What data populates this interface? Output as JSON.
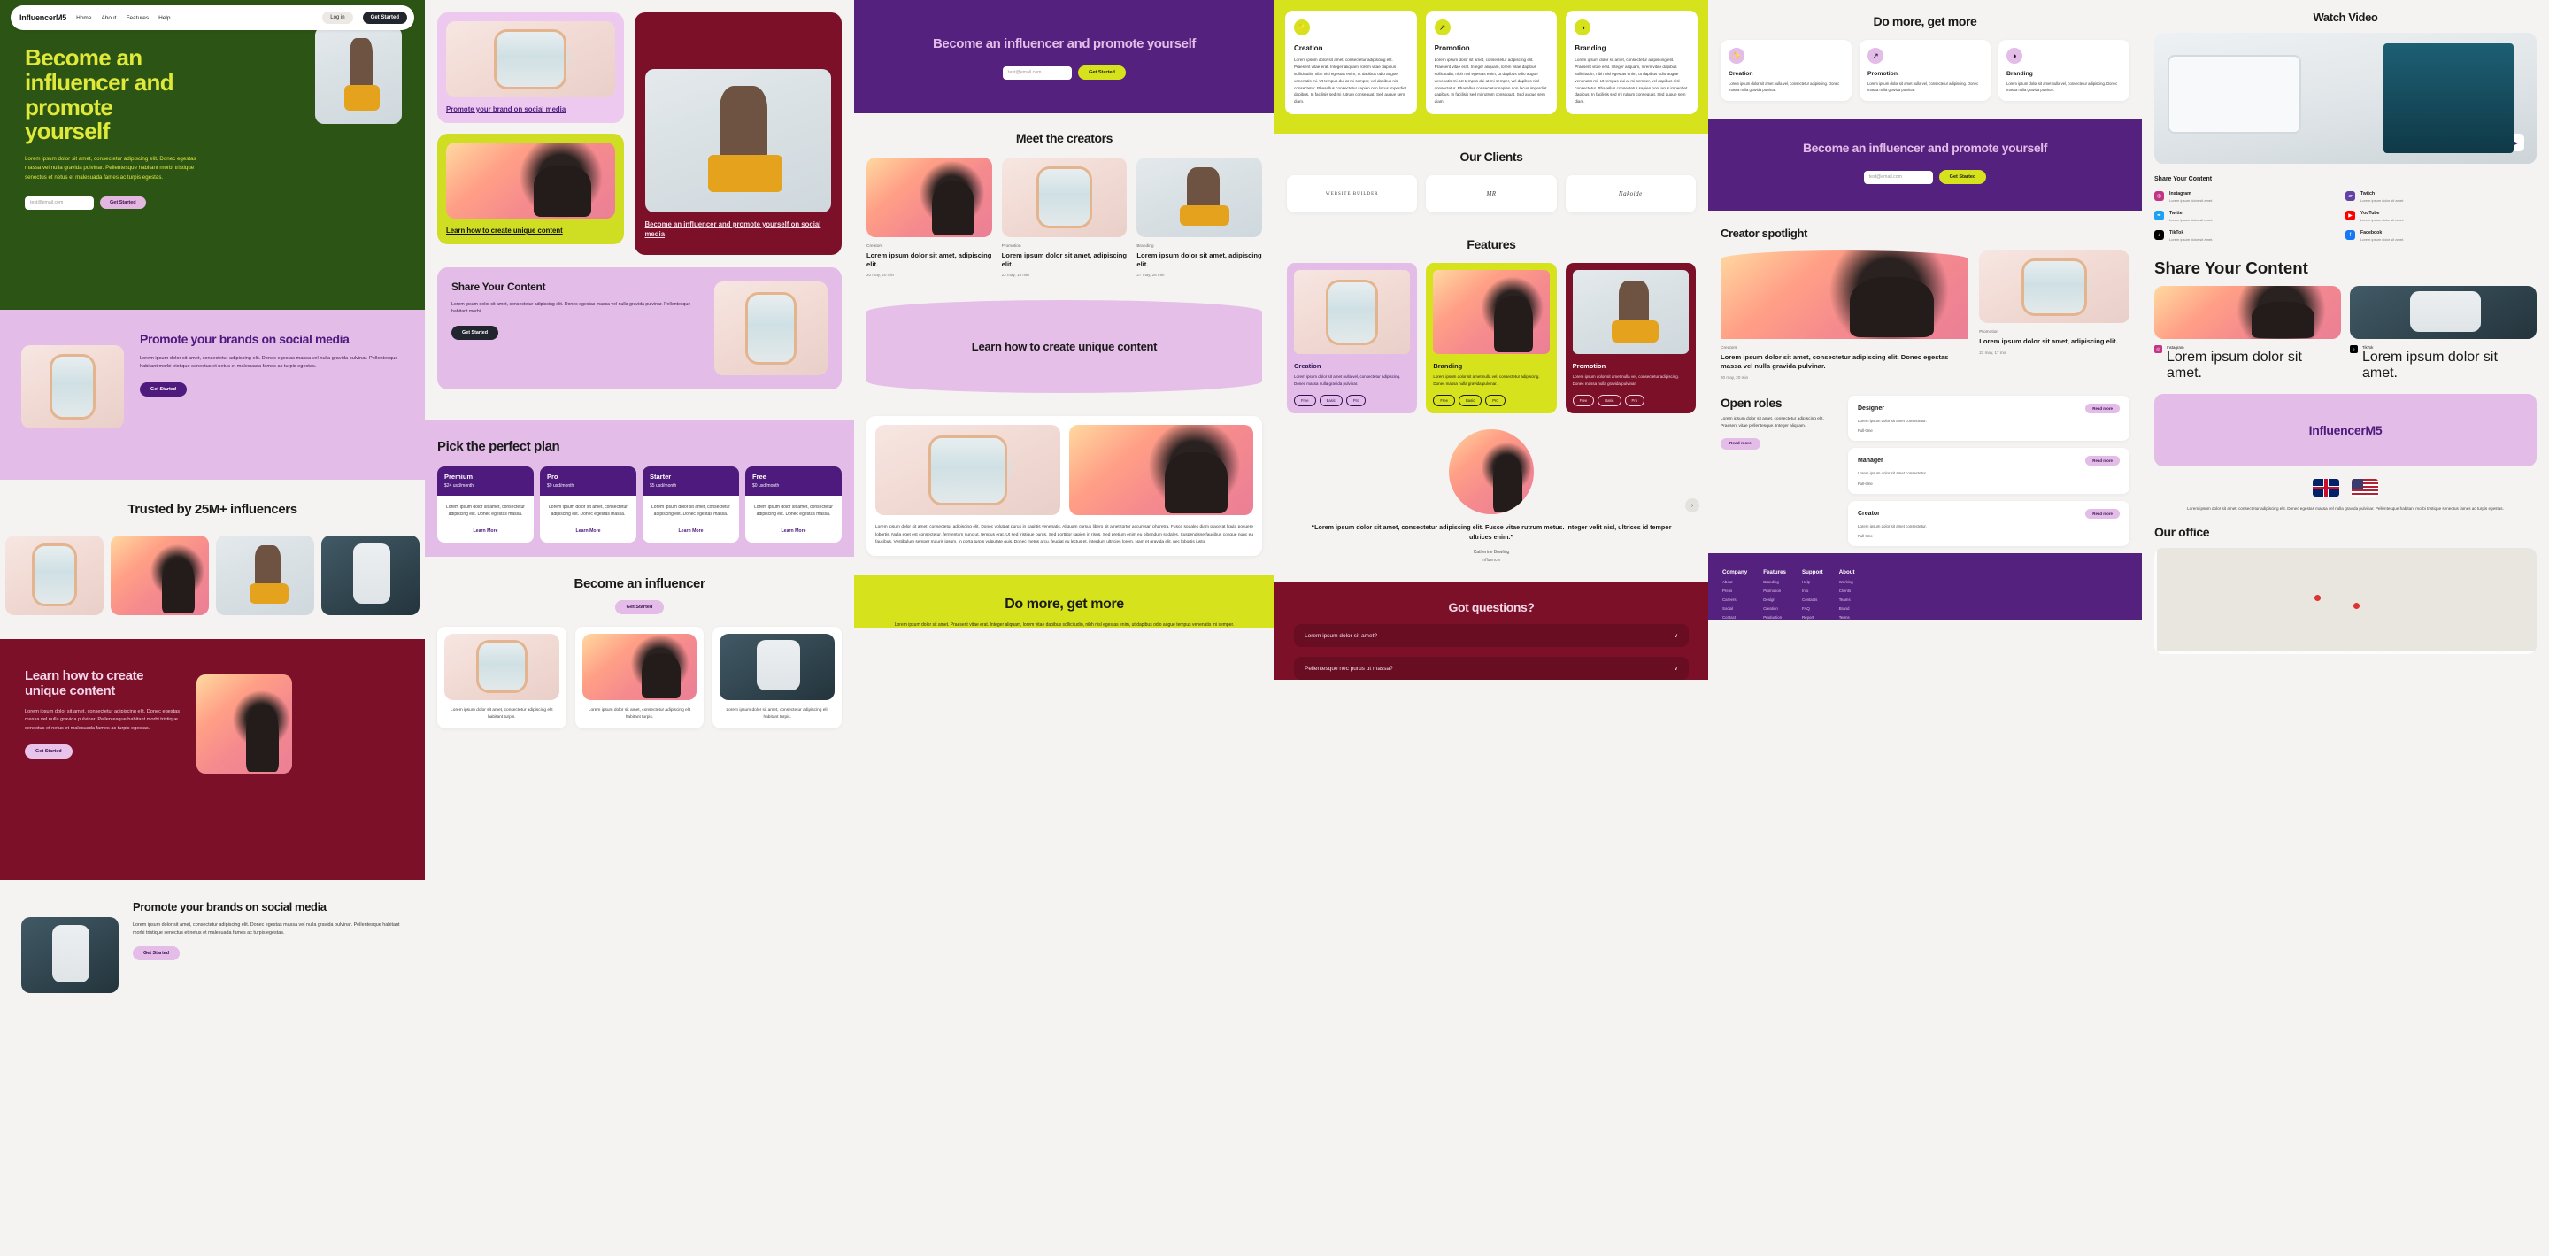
{
  "brand": "InfluencerM5",
  "nav": {
    "links": [
      "Home",
      "About",
      "Features",
      "Help"
    ],
    "login": "Log in",
    "get_started": "Get Started"
  },
  "common": {
    "get_started": "Get Started",
    "learn_more": "Learn More",
    "read_more": "Read more",
    "email_placeholder": "test@email.com",
    "lorem_long": "Lorem ipsum dolor sit amet, consectetur adipiscing elit. Donec egestas massa vel nulla gravida pulvinar. Pellentesque habitant morbi tristique senectus et netus et malesuada fames ac turpis egestas.",
    "lorem_mid": "Lorem ipsum dolor sit amet, consectetur adipiscing elit. Donec egestas massa vel nulla gravida pulvinar. Pellentesque habitant morbi.",
    "lorem_short": "Lorem ipsum dolor sit amet nulla vel, consectetur adipiscing. Donec massa nulla gravida pulvinar.",
    "lorem_card": "Lorem ipsum dolor sit amet, consectetur adipiscing elit. Donec egestas massa.",
    "lorem_tiny": "Lorem ipsum dolor sit amet, consectetur adipiscing elit habitant turpis."
  },
  "colors": {
    "green": "#2c5415",
    "lime": "#d6e31c",
    "lilac": "#e3bce8",
    "purple": "#55217e",
    "maroon": "#7c1028",
    "ink": "#22242e"
  },
  "hero_green": {
    "title": "Become an influencer and promote yourself",
    "body": "Lorem ipsum dolor sit amet, consectetur adipiscing elit. Donec egestas massa vel nulla gravida pulvinar. Pellentesque habitant morbi tristique senectus et netus et malesuada fames ac turpis egestas.",
    "cta": "Get Started"
  },
  "promote": {
    "title": "Promote your brands on social media",
    "body": "Lorem ipsum dolor sit amet, consectetur adipiscing elit. Donec egestas massa vel nulla gravida pulvinar. Pellentesque habitant morbi tristique senectus et netus et malesuada fames ac turpis egestas.",
    "cta": "Get Started"
  },
  "trusted": {
    "title": "Trusted by 25M+ influencers"
  },
  "learn": {
    "title": "Learn how to create unique content",
    "body": "Lorem ipsum dolor sit amet, consectetur adipiscing elit. Donec egestas massa vel nulla gravida pulvinar. Pellentesque habitant morbi tristique senectus et netus et malesuada fames ac turpis egestas.",
    "cta": "Get Started"
  },
  "promote2": {
    "title": "Promote your brands on social media",
    "body": "Lorem ipsum dolor sit amet, consectetur adipiscing elit. Donec egestas massa vel nulla gravida pulvinar. Pellentesque habitant morbi tristique senectus et netus et malesuada fames ac turpis egestas.",
    "cta": "Get Started"
  },
  "link_cards": {
    "lilac": "Promote your brand on social media",
    "lime": "Learn how to create unique content",
    "maroon": "Become an influencer and promote yourself on social media"
  },
  "share_content": {
    "title": "Share Your Content",
    "body": "Lorem ipsum dolor sit amet, consectetur adipiscing elit. Donec egestas massa vel nulla gravida pulvinar. Pellentesque habitant morbi.",
    "cta": "Get Started"
  },
  "pricing": {
    "title": "Pick the perfect plan",
    "plans": [
      {
        "name": "Premium",
        "price": "$24 usd/month",
        "desc": "Lorem ipsum dolor sit amet, consectetur adipiscing elit. Donec egestas massa.",
        "cta": "Learn More"
      },
      {
        "name": "Pro",
        "price": "$9 usd/month",
        "desc": "Lorem ipsum dolor sit amet, consectetur adipiscing elit. Donec egestas massa.",
        "cta": "Learn More"
      },
      {
        "name": "Starter",
        "price": "$5 usd/month",
        "desc": "Lorem ipsum dolor sit amet, consectetur adipiscing elit. Donec egestas massa.",
        "cta": "Learn More"
      },
      {
        "name": "Free",
        "price": "$0 usd/month",
        "desc": "Lorem ipsum dolor sit amet, consectetur adipiscing elit. Donec egestas massa.",
        "cta": "Learn More"
      }
    ]
  },
  "become_influencer": {
    "title": "Become an influencer",
    "cta": "Get Started",
    "cards": [
      {
        "text": "Lorem ipsum dolor sit amet, consectetur adipiscing elit habitant turpis."
      },
      {
        "text": "Lorem ipsum dolor sit amet, consectetur adipiscing elit habitant turpis."
      },
      {
        "text": "Lorem ipsum dolor sit amet, consectetur adipiscing elit habitant turpis."
      }
    ]
  },
  "hero_purple": {
    "title": "Become an influencer and promote yourself",
    "cta": "Get Started",
    "email_placeholder": "test@email.com"
  },
  "meet_creators": {
    "title": "Meet the creators",
    "cards": [
      {
        "category": "Creators",
        "title": "Lorem ipsum dolor sit amet, adipiscing elit.",
        "meta": "20 may, 20 min"
      },
      {
        "category": "Promotion",
        "title": "Lorem ipsum dolor sit amet, adipiscing elit.",
        "meta": "22 may, 18 min"
      },
      {
        "category": "Branding",
        "title": "Lorem ipsum dolor sit amet, adipiscing elit.",
        "meta": "27 may, 26 min"
      }
    ]
  },
  "learn_oval": {
    "title": "Learn how to create unique content"
  },
  "promo_block": {
    "text": "Lorem ipsum dolor sit amet, consectetur adipiscing elit. Donec volutpat purus in sagittis venenatis. Aliquam cursus libero sit amet tortor accumsan pharetra. Fusce sodales diam placerat ligula posuere lobortis. Nulla eget est consectetur, fermentum nunc ut, tempus erat. Ut sed tristique purus. Sed porttitor sapien in risus. Sed pretium enim eu bibendum sodales. Suspendisse faucibus congue nunc eu faucibus. Vestibulum semper mauris ipsum. In porta turpis vulputate quis. Donec metus arcu, feugiat eu lectus et, interdum ultricies lorem. Nam et gravida elit, nec lobortis justo."
  },
  "do_more_lime": {
    "title": "Do more, get more",
    "body": "Lorem ipsum dolor sit amet. Praesent vitae erat. Integer aliquam, lorem vitae dapibus sollicitudin, nibh nisl egestas enim, ut dapibus odio augue tempus venenatis mi semper."
  },
  "lime_features": {
    "cards": [
      {
        "icon": "lightbulb-icon",
        "glyph": "✨",
        "title": "Creation",
        "body": "Lorem ipsum dolor sit amet, consectetur adipiscing elit. Praesent vitae erat. Integer aliquam, lorem vitae dapibus sollicitudin, nibh nisl egestas enim, ut dapibus odio augue venenatis mi. Ut tempus dui at mi semper, vel dapibus nisl consectetur. Phasellus consectetur sapien non lacus imperdiet dapibus. In facilisis sed mi rutrum consequat. Sed augue sem diam."
      },
      {
        "icon": "trend-up-icon",
        "glyph": "↗",
        "title": "Promotion",
        "body": "Lorem ipsum dolor sit amet, consectetur adipiscing elit. Praesent vitae erat. Integer aliquam, lorem vitae dapibus sollicitudin, nibh nisl egestas enim, ut dapibus odio augue venenatis mi. Ut tempus dui at mi semper, vel dapibus nisl consectetur. Phasellus consectetur sapien non lacus imperdiet dapibus. In facilisis sed mi rutrum consequat. Sed augue sem diam."
      },
      {
        "icon": "palette-icon",
        "glyph": "◑",
        "title": "Branding",
        "body": "Lorem ipsum dolor sit amet, consectetur adipiscing elit. Praesent vitae erat. Integer aliquam, lorem vitae dapibus sollicitudin, nibh nisl egestas enim, ut dapibus odio augue venenatis mi. Ut tempus dui at mi semper, vel dapibus nisl consectetur. Phasellus consectetur sapien non lacus imperdiet dapibus. In facilisis sed mi rutrum consequat. Sed augue sem diam."
      }
    ]
  },
  "our_clients": {
    "title": "Our Clients",
    "logos": [
      "WEBSITE BUILDER",
      "MR",
      "Nakoide"
    ]
  },
  "features": {
    "title": "Features",
    "cards": [
      {
        "title": "Creation",
        "body": "Lorem ipsum dolor sit amet nulla vel, consectetur adipiscing. Donec massa nulla gravida pulvinar.",
        "tags": [
          "Free",
          "Basic",
          "Pro"
        ]
      },
      {
        "title": "Branding",
        "body": "Lorem ipsum dolor sit amet nulla vel, consectetur adipiscing. Donec massa nulla gravida pulvinar.",
        "tags": [
          "Free",
          "Basic",
          "Pro"
        ]
      },
      {
        "title": "Promotion",
        "body": "Lorem ipsum dolor sit amet nulla vel, consectetur adipiscing. Donec massa nulla gravida pulvinar.",
        "tags": [
          "Free",
          "Basic",
          "Pro"
        ]
      }
    ]
  },
  "testimonial": {
    "quote": "“Lorem ipsum dolor sit amet, consectetur adipiscing elit. Fusce vitae rutrum metus. Integer velit nisl, ultrices id tempor ultrices enim.”",
    "name": "Catherine Bowling",
    "role": "Influencer",
    "next_glyph": "›"
  },
  "faq": {
    "title": "Got questions?",
    "items": [
      {
        "q": "Lorem ipsum dolor sit amet?",
        "chevron": "∨"
      },
      {
        "q": "Pellentesque nec purus ut massa?",
        "chevron": "∨"
      }
    ]
  },
  "do_more": {
    "title": "Do more, get more",
    "cards": [
      {
        "icon": "lightbulb-icon",
        "glyph": "✨",
        "title": "Creation",
        "body": "Lorem ipsum dolor sit amet nulla vel, consectetur adipiscing. Donec massa nulla gravida pulvinar."
      },
      {
        "icon": "trend-up-icon",
        "glyph": "↗",
        "title": "Promotion",
        "body": "Lorem ipsum dolor sit amet nulla vel, consectetur adipiscing. Donec massa nulla gravida pulvinar."
      },
      {
        "icon": "palette-icon",
        "glyph": "◑",
        "title": "Branding",
        "body": "Lorem ipsum dolor sit amet nulla vel, consectetur adipiscing. Donec massa nulla gravida pulvinar."
      }
    ]
  },
  "cta_purple": {
    "title": "Become an influencer and promote yourself",
    "cta": "Get Started",
    "email_placeholder": "test@email.com"
  },
  "spotlight": {
    "title": "Creator spotlight",
    "main": {
      "category": "Creators",
      "title": "Lorem ipsum dolor sit amet, consectetur adipiscing elit. Donec egestas massa vel nulla gravida pulvinar.",
      "meta": "20 may, 20 min"
    },
    "side": {
      "category": "Promotion",
      "title": "Lorem ipsum dolor sit amet, adipiscing elit.",
      "meta": "23 may, 17 min"
    }
  },
  "open_roles": {
    "title": "Open roles",
    "body": "Lorem ipsum dolor sit amet, consectetur adipiscing elit. Praesent vitae pellentesque. Integer aliquam.",
    "cta": "Read more",
    "roles": [
      {
        "title": "Designer",
        "desc": "Lorem ipsum dolor sit amet consectetur.",
        "type": "Full-time",
        "cta": "Read more"
      },
      {
        "title": "Manager",
        "desc": "Lorem ipsum dolor sit amet consectetur.",
        "type": "Full-time",
        "cta": "Read more"
      },
      {
        "title": "Creator",
        "desc": "Lorem ipsum dolor sit amet consectetur.",
        "type": "Full-time",
        "cta": "Read more"
      }
    ]
  },
  "footer": {
    "columns": [
      {
        "heading": "Company",
        "links": [
          "About",
          "Press",
          "Careers",
          "Social",
          "Contact"
        ]
      },
      {
        "heading": "Features",
        "links": [
          "Branding",
          "Promotion",
          "Design",
          "Creation",
          "Production"
        ]
      },
      {
        "heading": "Support",
        "links": [
          "Help",
          "Info",
          "Contacts",
          "FAQ",
          "Report"
        ]
      },
      {
        "heading": "About",
        "links": [
          "Working",
          "Clients",
          "Teams",
          "Brand",
          "Terms"
        ]
      }
    ]
  },
  "watch_video": {
    "title": "Watch Video",
    "play_glyph": "▶"
  },
  "share_social": {
    "title": "Share Your Content",
    "items": [
      {
        "name": "Instagram",
        "glyph": "◎",
        "color": "#C13584",
        "sub": "Lorem ipsum dolor sit amet."
      },
      {
        "name": "Twitch",
        "glyph": "▰",
        "color": "#6441A5",
        "sub": "Lorem ipsum dolor sit amet."
      },
      {
        "name": "Twitter",
        "glyph": "✒",
        "color": "#1DA1F2",
        "sub": "Lorem ipsum dolor sit amet."
      },
      {
        "name": "YouTube",
        "glyph": "▶",
        "color": "#FF0000",
        "sub": "Lorem ipsum dolor sit amet."
      },
      {
        "name": "TikTok",
        "glyph": "♪",
        "color": "#010101",
        "sub": "Lorem ipsum dolor sit amet."
      },
      {
        "name": "Facebook",
        "glyph": "f",
        "color": "#1877F2",
        "sub": "Lorem ipsum dolor sit amet."
      }
    ]
  },
  "share_gallery": {
    "title": "Share Your Content",
    "items": [
      {
        "name": "Instagram",
        "glyph": "◎",
        "color": "#C13584",
        "sub": "Lorem ipsum dolor sit amet."
      },
      {
        "name": "TikTok",
        "glyph": "♪",
        "color": "#010101",
        "sub": "Lorem ipsum dolor sit amet."
      }
    ]
  },
  "brand_block": {
    "title": "InfluencerM5"
  },
  "flags": {
    "uk": "uk-flag",
    "us": "us-flag"
  },
  "tagline": "Lorem ipsum dolor sit amet, consectetur adipiscing elit. Donec egestas massa vel nulla gravida pulvinar. Pellentesque habitant morbi tristique senectus fames ac turpis egestas.",
  "office": {
    "title": "Our office"
  }
}
